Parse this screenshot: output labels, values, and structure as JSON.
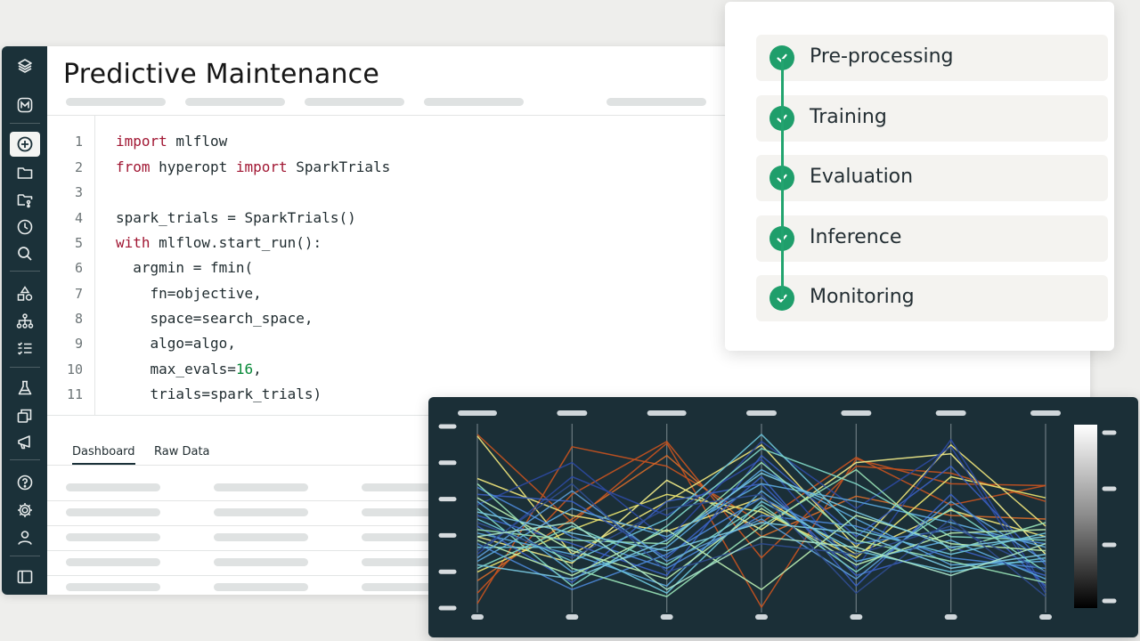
{
  "page": {
    "title": "Predictive Maintenance"
  },
  "sidebar": {
    "icons": [
      "layers-icon",
      "m-logo-icon",
      "new-plus-icon",
      "folder-icon",
      "repo-icon",
      "history-icon",
      "search-icon",
      "shapes-icon",
      "hierarchy-icon",
      "checklist-icon",
      "experiment-flask-icon",
      "models-copy-icon",
      "megaphone-icon",
      "help-icon",
      "settings-icon",
      "user-icon",
      "panel-toggle-icon"
    ]
  },
  "editor": {
    "line_numbers": [
      "1",
      "2",
      "3",
      "4",
      "5",
      "6",
      "7",
      "8",
      "9",
      "10",
      "11"
    ],
    "lines": [
      {
        "kw1": "import",
        "rest": " mlflow"
      },
      {
        "kw1": "from",
        "mid": " hyperopt ",
        "kw2": "import",
        "rest": " SparkTrials"
      },
      {
        "rest": ""
      },
      {
        "rest": "spark_trials = SparkTrials()"
      },
      {
        "kw1": "with",
        "rest": " mlflow.start_run():"
      },
      {
        "rest": "  argmin = fmin("
      },
      {
        "rest": "    fn=objective,"
      },
      {
        "rest": "    space=search_space,"
      },
      {
        "rest": "    algo=algo,"
      },
      {
        "rest": "    max_evals=",
        "num": "16",
        "tail": ","
      },
      {
        "rest": "    trials=spark_trials)"
      }
    ]
  },
  "tabs": {
    "dashboard": "Dashboard",
    "raw_data": "Raw Data"
  },
  "pipeline": {
    "steps": [
      {
        "label": "Pre-processing",
        "status": "done"
      },
      {
        "label": "Training",
        "status": "done"
      },
      {
        "label": "Evaluation",
        "status": "done"
      },
      {
        "label": "Inference",
        "status": "done"
      },
      {
        "label": "Monitoring",
        "status": "done"
      }
    ],
    "accent": "#1f9e6b"
  },
  "colors": {
    "sidebar_bg": "#1b3139",
    "keyword": "#a11733",
    "number": "#0a8a3a",
    "chart_bg": "#1b2f37"
  },
  "chart_data": {
    "type": "line",
    "title": "",
    "axes_count": 7,
    "colorbar": "grayscale",
    "series": [
      {
        "color": "#c4521f",
        "values": [
          0.98,
          0.48,
          0.93,
          0.0,
          0.84,
          0.7,
          0.69
        ]
      },
      {
        "color": "#c4521f",
        "values": [
          0.02,
          0.91,
          0.8,
          0.48,
          0.85,
          0.58,
          0.69
        ]
      },
      {
        "color": "#c4521f",
        "values": [
          0.08,
          0.64,
          0.94,
          0.28,
          0.8,
          0.76,
          0.6
        ]
      },
      {
        "color": "#d46a2a",
        "values": [
          0.15,
          0.5,
          0.86,
          0.4,
          0.63,
          0.52,
          0.5
        ]
      },
      {
        "color": "#ede37a",
        "values": [
          0.97,
          0.3,
          0.6,
          0.92,
          0.34,
          0.92,
          0.46
        ]
      },
      {
        "color": "#ede37a",
        "values": [
          0.73,
          0.52,
          0.43,
          0.62,
          0.3,
          0.55,
          0.4
        ]
      },
      {
        "color": "#f0ea88",
        "values": [
          0.4,
          0.25,
          0.72,
          0.44,
          0.82,
          0.87,
          0.3
        ]
      },
      {
        "color": "#e9e46f",
        "values": [
          0.2,
          0.44,
          0.64,
          0.54,
          0.28,
          0.74,
          0.62
        ]
      },
      {
        "color": "#2c4aa0",
        "values": [
          0.58,
          0.82,
          0.38,
          0.94,
          0.56,
          0.91,
          0.08
        ]
      },
      {
        "color": "#2c4aa0",
        "values": [
          0.3,
          0.74,
          0.52,
          0.84,
          0.22,
          0.95,
          0.1
        ]
      },
      {
        "color": "#3a5fbf",
        "values": [
          0.52,
          0.36,
          0.18,
          0.86,
          0.4,
          0.8,
          0.24
        ]
      },
      {
        "color": "#3a5fbf",
        "values": [
          0.46,
          0.14,
          0.6,
          0.7,
          0.18,
          0.34,
          0.18
        ]
      },
      {
        "color": "#3a5fbf",
        "values": [
          0.64,
          0.6,
          0.28,
          0.74,
          0.12,
          0.64,
          0.12
        ]
      },
      {
        "color": "#4a86d4",
        "values": [
          0.36,
          0.1,
          0.3,
          0.62,
          0.36,
          0.44,
          0.36
        ]
      },
      {
        "color": "#4a86d4",
        "values": [
          0.68,
          0.4,
          0.22,
          0.52,
          0.46,
          0.28,
          0.22
        ]
      },
      {
        "color": "#5ba8dc",
        "values": [
          0.6,
          0.2,
          0.34,
          0.78,
          0.5,
          0.24,
          0.26
        ]
      },
      {
        "color": "#5ba8dc",
        "values": [
          0.42,
          0.3,
          0.12,
          0.66,
          0.26,
          0.38,
          0.16
        ]
      },
      {
        "color": "#5ba8dc",
        "values": [
          0.26,
          0.56,
          0.4,
          0.7,
          0.6,
          0.48,
          0.34
        ]
      },
      {
        "color": "#6bc4d9",
        "values": [
          0.5,
          0.26,
          0.5,
          0.98,
          0.44,
          0.3,
          0.42
        ]
      },
      {
        "color": "#6bc4d9",
        "values": [
          0.34,
          0.34,
          0.08,
          0.6,
          0.32,
          0.2,
          0.28
        ]
      },
      {
        "color": "#7fd6c4",
        "values": [
          0.56,
          0.12,
          0.46,
          0.9,
          0.7,
          0.4,
          0.38
        ]
      },
      {
        "color": "#7fd6c4",
        "values": [
          0.22,
          0.46,
          0.24,
          0.58,
          0.2,
          0.56,
          0.2
        ]
      },
      {
        "color": "#96e0b4",
        "values": [
          0.7,
          0.22,
          0.06,
          0.46,
          0.78,
          0.32,
          0.48
        ]
      },
      {
        "color": "#96e0b4",
        "values": [
          0.44,
          0.38,
          0.36,
          0.82,
          0.38,
          0.26,
          0.14
        ]
      },
      {
        "color": "#b8ecb0",
        "values": [
          0.38,
          0.18,
          0.44,
          0.1,
          0.52,
          0.36,
          0.32
        ]
      },
      {
        "color": "#b8ecb0",
        "values": [
          0.62,
          0.32,
          0.16,
          0.56,
          0.24,
          0.42,
          0.44
        ]
      },
      {
        "color": "#5a9ad4",
        "values": [
          0.28,
          0.66,
          0.26,
          0.5,
          0.16,
          0.6,
          0.26
        ]
      },
      {
        "color": "#2f4c8e",
        "values": [
          0.48,
          0.28,
          0.56,
          0.64,
          0.08,
          0.5,
          0.06
        ]
      },
      {
        "color": "#2f4c8e",
        "values": [
          0.32,
          0.7,
          0.2,
          0.36,
          0.3,
          0.46,
          0.2
        ]
      },
      {
        "color": "#78c8e0",
        "values": [
          0.54,
          0.42,
          0.32,
          0.48,
          0.42,
          0.22,
          0.3
        ]
      },
      {
        "color": "#78c8e0",
        "values": [
          0.24,
          0.16,
          0.38,
          0.76,
          0.54,
          0.34,
          0.4
        ]
      },
      {
        "color": "#a8e4c8",
        "values": [
          0.4,
          0.48,
          0.1,
          0.4,
          0.34,
          0.18,
          0.36
        ]
      }
    ]
  }
}
